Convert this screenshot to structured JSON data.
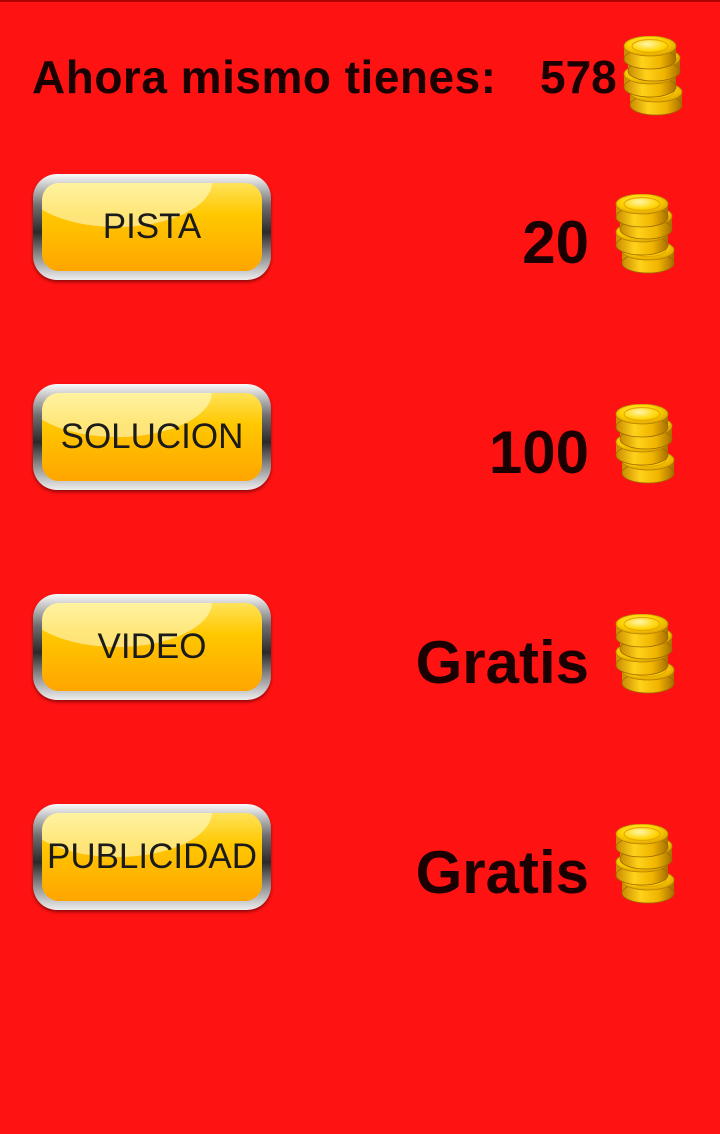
{
  "header": {
    "label": "Ahora mismo tienes:",
    "coins": "578",
    "coin_icon": "coin-stack-icon"
  },
  "colors": {
    "background": "#ff1212",
    "button_face": "#ffc800",
    "text": "#1a0000"
  },
  "options": [
    {
      "id": "pista",
      "label": "PISTA",
      "cost": "20",
      "icon": "coin-stack-icon"
    },
    {
      "id": "solucion",
      "label": "SOLUCION",
      "cost": "100",
      "icon": "coin-stack-icon"
    },
    {
      "id": "video",
      "label": "VIDEO",
      "cost": "Gratis",
      "icon": "coin-stack-icon"
    },
    {
      "id": "publicidad",
      "label": "PUBLICIDAD",
      "cost": "Gratis",
      "icon": "coin-stack-icon"
    }
  ]
}
